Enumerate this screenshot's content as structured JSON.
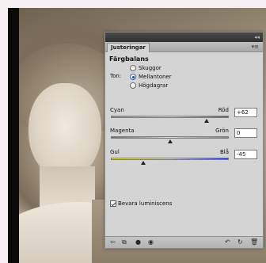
{
  "panel": {
    "tab_label": "Justeringar",
    "heading": "Färgbalans",
    "ton_label": "Ton:",
    "tones": [
      {
        "label": "Skuggor",
        "selected": false
      },
      {
        "label": "Mellantoner",
        "selected": true
      },
      {
        "label": "Högdagrar",
        "selected": false
      }
    ],
    "sliders": [
      {
        "left": "Cyan",
        "right": "Röd",
        "value": "+62",
        "amount": 62,
        "colors": [
          "#00c8d8",
          "#e02020"
        ]
      },
      {
        "left": "Magenta",
        "right": "Grön",
        "value": "0",
        "amount": 0,
        "colors": [
          "#d020d0",
          "#20c020"
        ]
      },
      {
        "left": "Gul",
        "right": "Blå",
        "value": "-45",
        "amount": -45,
        "colors": [
          "#e8e020",
          "#2030e0"
        ]
      }
    ],
    "preserve_luminosity": {
      "label": "Bevara luminiscens",
      "checked": true
    }
  }
}
